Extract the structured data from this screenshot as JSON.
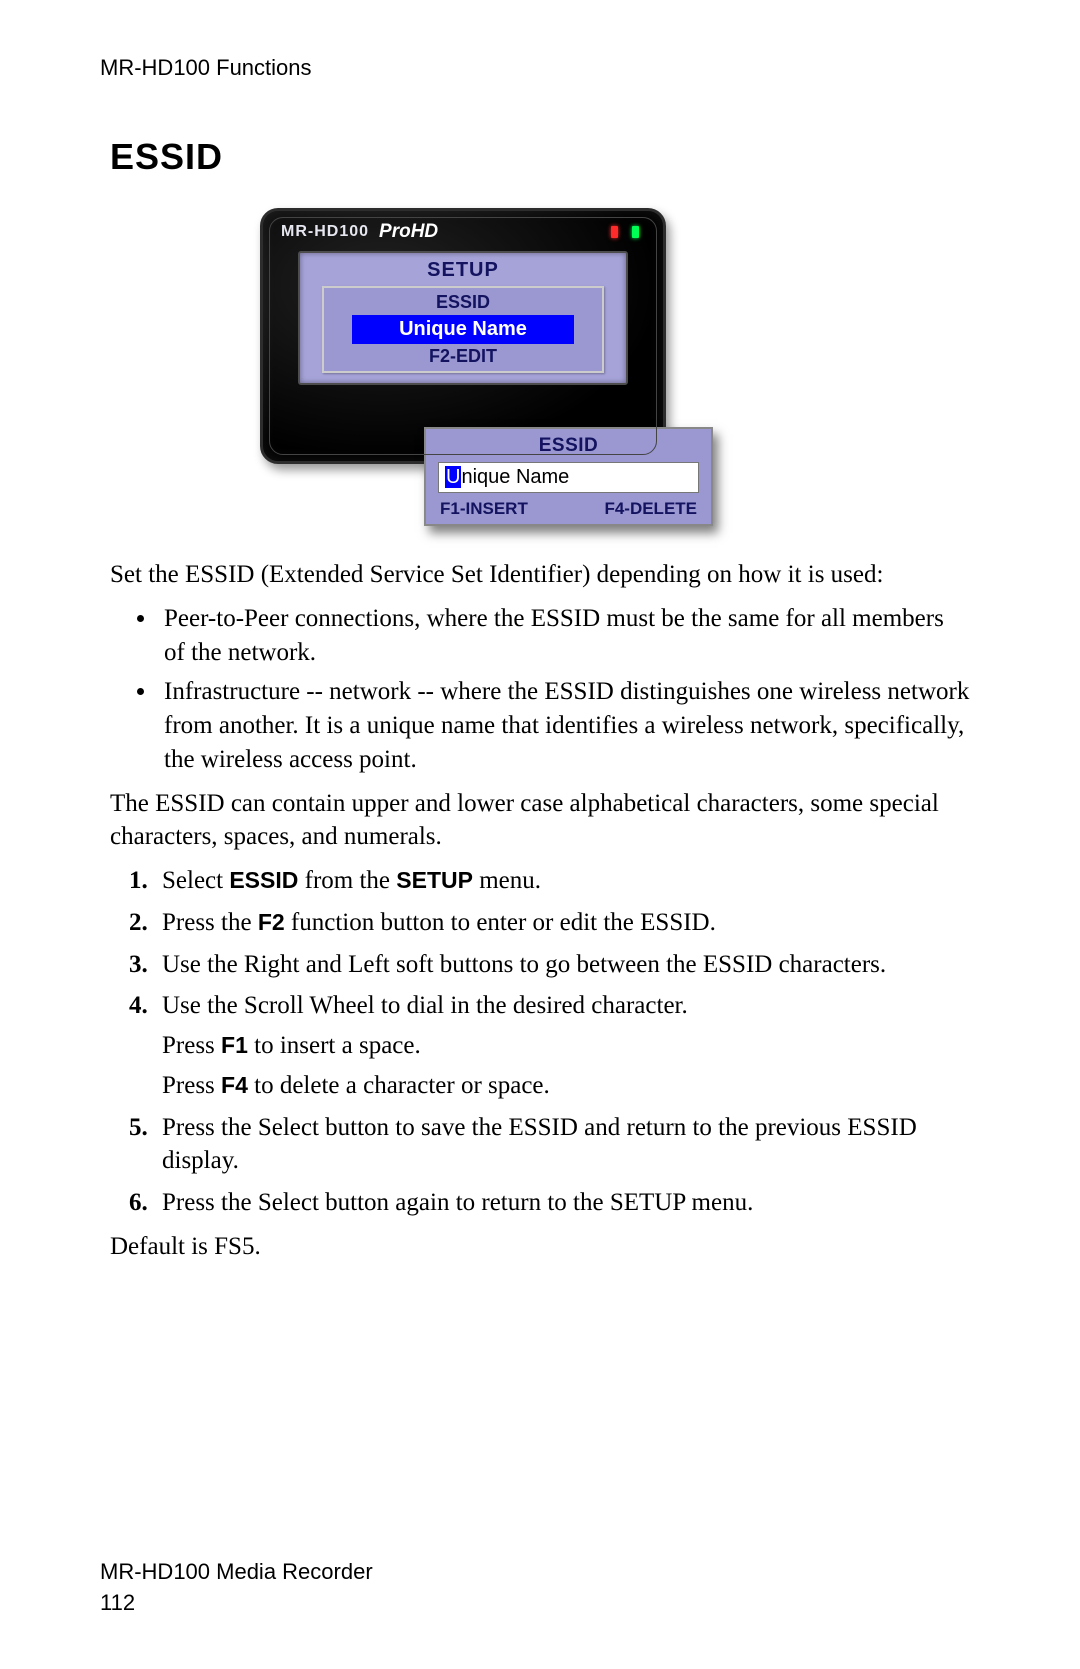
{
  "header": "MR-HD100 Functions",
  "section_title": "ESSID",
  "device": {
    "model": "MR-HD100",
    "logo": "ProHD",
    "screen_title": "SETUP",
    "inner_label": "ESSID",
    "inner_value": "Unique Name",
    "inner_hint": "F2-EDIT",
    "popup_title": "ESSID",
    "popup_cursor_char": "U",
    "popup_value_rest": "nique Name",
    "popup_key_left": "F1-INSERT",
    "popup_key_right": "F4-DELETE"
  },
  "intro": "Set the ESSID (Extended Service Set Identifier) depending on how it is used:",
  "bullets": [
    "Peer-to-Peer connections, where the ESSID must be the same for all members of the network.",
    "Infrastructure -- network -- where the ESSID distinguishes one wireless network from another. It is a unique name that identifies a wireless network, specifically, the wireless access point."
  ],
  "chars_note": "The ESSID can contain upper and lower case alphabetical characters, some special characters, spaces, and numerals.",
  "steps": {
    "s1_a": "Select ",
    "s1_b": "ESSID",
    "s1_c": " from the ",
    "s1_d": "SETUP",
    "s1_e": " menu.",
    "s2_a": "Press the ",
    "s2_b": "F2",
    "s2_c": " function button to enter or edit the ESSID.",
    "s3": "Use the Right and Left soft buttons to go between the ESSID characters.",
    "s4_a": "Use the Scroll Wheel to dial in the desired character.",
    "s4_b1": "Press ",
    "s4_b2": "F1",
    "s4_b3": " to insert a space.",
    "s4_c1": "Press ",
    "s4_c2": "F4",
    "s4_c3": " to delete a character or space.",
    "s5": "Press the Select button to save the ESSID and return to the previous ESSID display.",
    "s6": "Press the Select button again to return to the SETUP menu."
  },
  "default_note": "Default is FS5.",
  "footer_line1": "MR-HD100 Media Recorder",
  "footer_line2": "112"
}
